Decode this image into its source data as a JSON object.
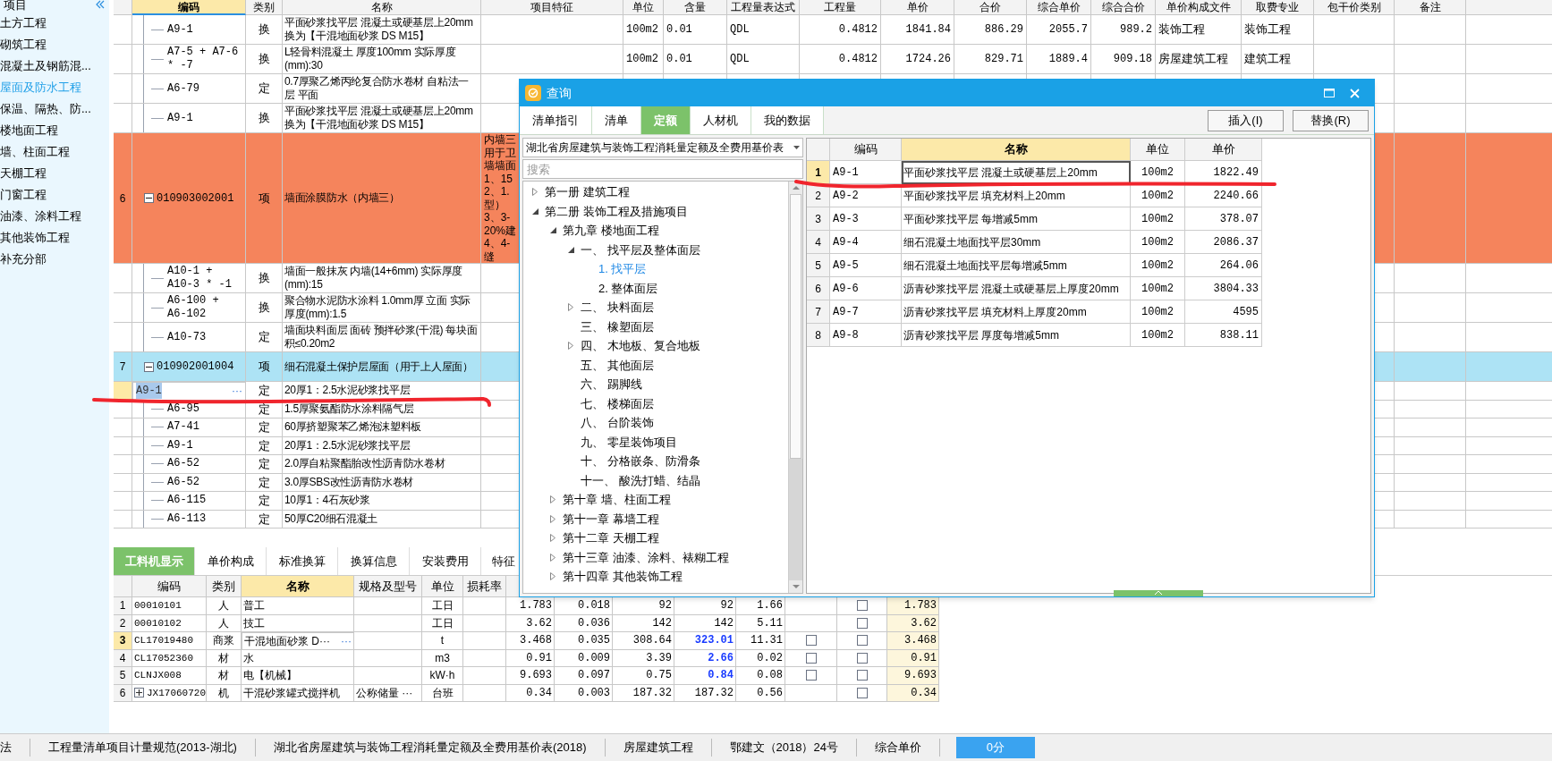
{
  "sidebar": {
    "header": "项目",
    "items": [
      {
        "label": "土方工程",
        "selected": false
      },
      {
        "label": "砌筑工程",
        "selected": false
      },
      {
        "label": "混凝土及钢筋混...",
        "selected": false
      },
      {
        "label": "屋面及防水工程",
        "selected": true
      },
      {
        "label": "保温、隔热、防...",
        "selected": false
      },
      {
        "label": "楼地面工程",
        "selected": false
      },
      {
        "label": "墙、柱面工程",
        "selected": false
      },
      {
        "label": "天棚工程",
        "selected": false
      },
      {
        "label": "门窗工程",
        "selected": false
      },
      {
        "label": "油漆、涂料工程",
        "selected": false
      },
      {
        "label": "其他装饰工程",
        "selected": false
      },
      {
        "label": "补充分部",
        "selected": false
      }
    ]
  },
  "main_table": {
    "columns": [
      {
        "label": "编码",
        "selected": true
      },
      {
        "label": "类别",
        "selected": false
      },
      {
        "label": "名称",
        "selected": false
      },
      {
        "label": "项目特征",
        "selected": false
      },
      {
        "label": "单位",
        "selected": false
      },
      {
        "label": "含量",
        "selected": false
      },
      {
        "label": "工程量表达式",
        "selected": false
      },
      {
        "label": "工程量",
        "selected": false
      },
      {
        "label": "单价",
        "selected": false
      },
      {
        "label": "合价",
        "selected": false
      },
      {
        "label": "综合单价",
        "selected": false
      },
      {
        "label": "综合合价",
        "selected": false
      },
      {
        "label": "单价构成文件",
        "selected": false
      },
      {
        "label": "取费专业",
        "selected": false
      },
      {
        "label": "包干价类别",
        "selected": false
      },
      {
        "label": "备注",
        "selected": false
      }
    ],
    "rows": [
      {
        "kind": "sub",
        "code": "A9-1",
        "type": "换",
        "name": "平面砂浆找平层 混凝土或硬基层上20mm 换为【干混地面砂浆 DS M15】",
        "unit": "100m2",
        "content": "0.01",
        "expr": "QDL",
        "qty": "0.4812",
        "price": "1841.84",
        "amount": "886.29",
        "comp_price": "2055.7",
        "comp_amount": "989.2",
        "price_file": "装饰工程",
        "fee_major": "装饰工程"
      },
      {
        "kind": "sub",
        "code": "A7-5 + A7-6 * -7",
        "type": "换",
        "name": "L轻骨料混凝土 厚度100mm  实际厚度(mm):30",
        "unit": "100m2",
        "content": "0.01",
        "expr": "QDL",
        "qty": "0.4812",
        "price": "1724.26",
        "amount": "829.71",
        "comp_price": "1889.4",
        "comp_amount": "909.18",
        "price_file": "房屋建筑工程",
        "fee_major": "建筑工程"
      },
      {
        "kind": "sub",
        "code": "A6-79",
        "type": "定",
        "name": "0.7厚聚乙烯丙纶复合防水卷材 自粘法一层 平面"
      },
      {
        "kind": "sub",
        "code": "A9-1",
        "type": "换",
        "name": "平面砂浆找平层 混凝土或硬基层上20mm 换为【干混地面砂浆 DS M15】"
      },
      {
        "kind": "item",
        "num": "6",
        "code": "010903002001",
        "type": "项",
        "name": "墙面涂膜防水（内墙三）",
        "expanded": true,
        "color": "#f5845c",
        "feature": [
          "内墙三",
          "用于卫",
          "墙墙面",
          "1、15",
          "2、1.",
          "型）",
          "3、3-",
          "20%建",
          "4、4-",
          "缝"
        ]
      },
      {
        "kind": "sub",
        "code": "A10-1 + A10-3 * -1",
        "type": "换",
        "name": "墙面一般抹灰 内墙(14+6mm)  实际厚度(mm):15"
      },
      {
        "kind": "sub",
        "code": "A6-100 + A6-102",
        "type": "换",
        "name": "聚合物水泥防水涂料 1.0mm厚 立面  实际厚度(mm):1.5"
      },
      {
        "kind": "sub",
        "code": "A10-73",
        "type": "定",
        "name": "墙面块料面层 面砖 预拌砂浆(干混) 每块面积≤0.20m2"
      },
      {
        "kind": "item",
        "num": "7",
        "code": "010902001004",
        "type": "项",
        "name": "细石混凝土保护层屋面（用于上人屋面）",
        "expanded": true,
        "color": "#ade3f5"
      },
      {
        "kind": "edit",
        "code": "A9-1",
        "more": "···",
        "type": "定",
        "name": "20厚1：2.5水泥砂浆找平层"
      },
      {
        "kind": "sub",
        "code": "A6-95",
        "type": "定",
        "name": "1.5厚聚氨酯防水涂料隔气层"
      },
      {
        "kind": "sub",
        "code": "A7-41",
        "type": "定",
        "name": "60厚挤塑聚苯乙烯泡沫塑料板"
      },
      {
        "kind": "sub",
        "code": "A9-1",
        "type": "定",
        "name": "20厚1：2.5水泥砂浆找平层"
      },
      {
        "kind": "sub",
        "code": "A6-52",
        "type": "定",
        "name": "2.0厚自粘聚酯胎改性沥青防水卷材"
      },
      {
        "kind": "sub",
        "code": "A6-52",
        "type": "定",
        "name": "3.0厚SBS改性沥青防水卷材"
      },
      {
        "kind": "sub",
        "code": "A6-115",
        "type": "定",
        "name": "10厚1：4石灰砂浆"
      },
      {
        "kind": "sub",
        "code": "A6-113",
        "type": "定",
        "name": "50厚C20细石混凝土"
      }
    ]
  },
  "bottom_panel": {
    "tabs": [
      {
        "label": "工料机显示",
        "selected": true
      },
      {
        "label": "单价构成",
        "selected": false
      },
      {
        "label": "标准换算",
        "selected": false
      },
      {
        "label": "换算信息",
        "selected": false
      },
      {
        "label": "安装费用",
        "selected": false
      },
      {
        "label": "特征",
        "selected": false
      }
    ],
    "columns": [
      {
        "label": "编码",
        "selected": false
      },
      {
        "label": "类别",
        "selected": false
      },
      {
        "label": "名称",
        "selected": true
      },
      {
        "label": "规格及型号",
        "selected": false
      },
      {
        "label": "单位",
        "selected": false
      },
      {
        "label": "损耗率",
        "selected": false
      }
    ],
    "rows": [
      {
        "num": "1",
        "code": "00010101",
        "type": "人",
        "name": "普工",
        "unit": "工日",
        "values": [
          "1.783",
          "0.018",
          "92",
          "92",
          "1.66"
        ],
        "check_b": false,
        "total": "1.783",
        "selected": false,
        "price_changed": false
      },
      {
        "num": "2",
        "code": "00010102",
        "type": "人",
        "name": "技工",
        "unit": "工日",
        "values": [
          "3.62",
          "0.036",
          "142",
          "142",
          "5.11"
        ],
        "check_b": false,
        "total": "3.62",
        "selected": false,
        "price_changed": false
      },
      {
        "num": "3",
        "code": "CL17019480",
        "type": "商浆",
        "name": "干混地面砂浆 D···",
        "more": "···",
        "unit": "t",
        "values": [
          "3.468",
          "0.035",
          "308.64",
          "323.01",
          "11.31"
        ],
        "check_a": false,
        "check_b": false,
        "total": "3.468",
        "selected": true,
        "price_changed": true
      },
      {
        "num": "4",
        "code": "CL17052360",
        "type": "材",
        "name": "水",
        "unit": "m3",
        "values": [
          "0.91",
          "0.009",
          "3.39",
          "2.66",
          "0.02"
        ],
        "check_a": false,
        "check_b": false,
        "total": "0.91",
        "selected": false,
        "price_changed": true
      },
      {
        "num": "5",
        "code": "CLNJX008",
        "type": "材",
        "name": "电【机械】",
        "unit": "kW·h",
        "values": [
          "9.693",
          "0.097",
          "0.75",
          "0.84",
          "0.08"
        ],
        "check_a": false,
        "check_b": false,
        "total": "9.693",
        "selected": false,
        "price_changed": true
      },
      {
        "num": "6",
        "code": "JX17060720",
        "expanded": false,
        "type": "机",
        "name": "干混砂浆罐式搅拌机",
        "spec": "公称储量 ···",
        "unit": "台班",
        "values": [
          "0.34",
          "0.003",
          "187.32",
          "187.32",
          "0.56"
        ],
        "check_b": false,
        "total": "0.34",
        "selected": false,
        "price_changed": false
      }
    ]
  },
  "dialog": {
    "title": "查询",
    "tabs": [
      {
        "label": "清单指引",
        "selected": false
      },
      {
        "label": "清单",
        "selected": false
      },
      {
        "label": "定额",
        "selected": true
      },
      {
        "label": "人材机",
        "selected": false
      },
      {
        "label": "我的数据",
        "selected": false
      }
    ],
    "buttons": [
      "插入(I)",
      "替换(R)"
    ],
    "library": "湖北省房屋建筑与装饰工程消耗量定额及全费用基价表",
    "search": {
      "placeholder": "搜索"
    },
    "tree": [
      {
        "label": "第一册 建筑工程",
        "expanded": false,
        "selected": false
      },
      {
        "label": "第二册 装饰工程及措施项目",
        "expanded": true,
        "selected": false,
        "children": [
          {
            "label": "第九章 楼地面工程",
            "expanded": true,
            "selected": false,
            "children": [
              {
                "label": "一、 找平层及整体面层",
                "expanded": true,
                "selected": false,
                "children": [
                  {
                    "label": "1. 找平层",
                    "selected": true
                  },
                  {
                    "label": "2. 整体面层",
                    "selected": false
                  }
                ]
              },
              {
                "label": "二、 块料面层",
                "expanded": false,
                "selected": false
              },
              {
                "label": "三、 橡塑面层",
                "selected": false
              },
              {
                "label": "四、 木地板、复合地板",
                "expanded": false,
                "selected": false
              },
              {
                "label": "五、 其他面层",
                "selected": false
              },
              {
                "label": "六、 踢脚线",
                "selected": false
              },
              {
                "label": "七、 楼梯面层",
                "selected": false
              },
              {
                "label": "八、 台阶装饰",
                "selected": false
              },
              {
                "label": "九、 零星装饰项目",
                "selected": false
              },
              {
                "label": "十、 分格嵌条、防滑条",
                "selected": false
              },
              {
                "label": "十一、 酸洗打蜡、结晶",
                "selected": false
              }
            ]
          },
          {
            "label": "第十章 墙、柱面工程",
            "expanded": false,
            "selected": false
          },
          {
            "label": "第十一章 幕墙工程",
            "expanded": false,
            "selected": false
          },
          {
            "label": "第十二章 天棚工程",
            "expanded": false,
            "selected": false
          },
          {
            "label": "第十三章 油漆、涂料、裱糊工程",
            "expanded": false,
            "selected": false
          },
          {
            "label": "第十四章 其他装饰工程",
            "expanded": false,
            "selected": false
          }
        ]
      }
    ],
    "grid": {
      "columns": [
        {
          "label": "编码",
          "selected": false
        },
        {
          "label": "名称",
          "selected": true
        },
        {
          "label": "单位",
          "selected": false
        },
        {
          "label": "单价",
          "selected": false
        }
      ],
      "rows": [
        {
          "num": "1",
          "code": "A9-1",
          "name": "平面砂浆找平层 混凝土或硬基层上20mm",
          "unit": "100m2",
          "price": "1822.49",
          "selected": true
        },
        {
          "num": "2",
          "code": "A9-2",
          "name": "平面砂浆找平层 填充材料上20mm",
          "unit": "100m2",
          "price": "2240.66",
          "selected": false
        },
        {
          "num": "3",
          "code": "A9-3",
          "name": "平面砂浆找平层 每增减5mm",
          "unit": "100m2",
          "price": "378.07",
          "selected": false
        },
        {
          "num": "4",
          "code": "A9-4",
          "name": "细石混凝土地面找平层30mm",
          "unit": "100m2",
          "price": "2086.37",
          "selected": false
        },
        {
          "num": "5",
          "code": "A9-5",
          "name": "细石混凝土地面找平层每增减5mm",
          "unit": "100m2",
          "price": "264.06",
          "selected": false
        },
        {
          "num": "6",
          "code": "A9-6",
          "name": "沥青砂浆找平层 混凝土或硬基层上厚度20mm",
          "unit": "100m2",
          "price": "3804.33",
          "selected": false
        },
        {
          "num": "7",
          "code": "A9-7",
          "name": "沥青砂浆找平层 填充材料上厚度20mm",
          "unit": "100m2",
          "price": "4595",
          "selected": false
        },
        {
          "num": "8",
          "code": "A9-8",
          "name": "沥青砂浆找平层 厚度每增减5mm",
          "unit": "100m2",
          "price": "838.11",
          "selected": false
        }
      ]
    }
  },
  "status_bar": {
    "items": [
      "法",
      "工程量清单项目计量规范(2013-湖北)",
      "湖北省房屋建筑与装饰工程消耗量定额及全费用基价表(2018)",
      "房屋建筑工程",
      "鄂建文（2018）24号",
      "综合单价"
    ],
    "button": "0分"
  }
}
